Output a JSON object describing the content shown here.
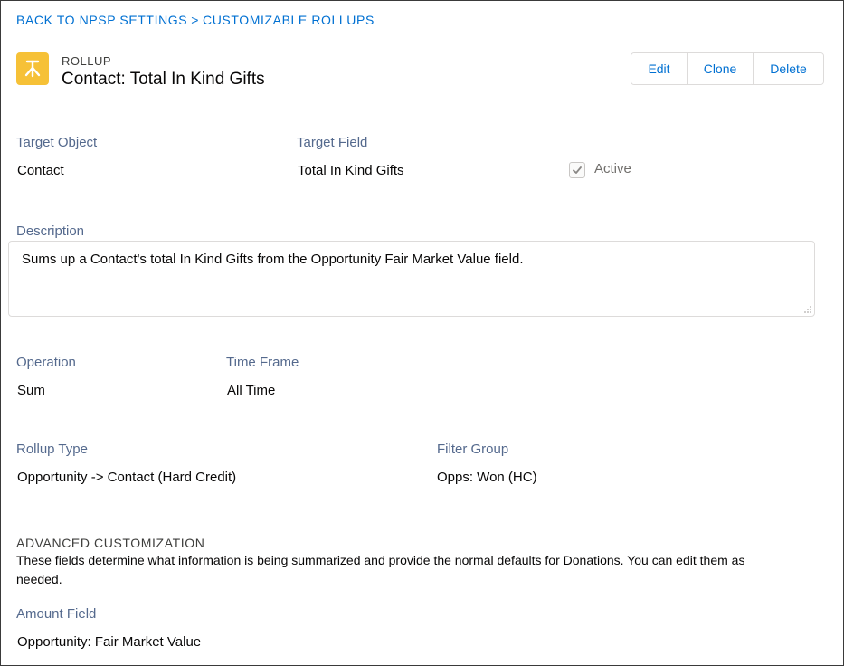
{
  "breadcrumb": {
    "back_label": "BACK TO NPSP SETTINGS",
    "separator": ">",
    "current_label": "CUSTOMIZABLE ROLLUPS"
  },
  "header": {
    "object_type": "ROLLUP",
    "title": "Contact: Total In Kind Gifts",
    "icon": "rollup-icon",
    "icon_color": "#f6c137"
  },
  "actions": {
    "edit_label": "Edit",
    "clone_label": "Clone",
    "delete_label": "Delete"
  },
  "fields": {
    "target_object": {
      "label": "Target Object",
      "value": "Contact"
    },
    "target_field": {
      "label": "Target Field",
      "value": "Total In Kind Gifts"
    },
    "active": {
      "label": "Active",
      "checked": true
    },
    "description": {
      "label": "Description",
      "value": "Sums up a Contact's total In Kind Gifts from the Opportunity Fair Market Value field."
    },
    "operation": {
      "label": "Operation",
      "value": "Sum"
    },
    "time_frame": {
      "label": "Time Frame",
      "value": "All Time"
    },
    "rollup_type": {
      "label": "Rollup Type",
      "value": "Opportunity -> Contact (Hard Credit)"
    },
    "filter_group": {
      "label": "Filter Group",
      "value": "Opps: Won (HC)"
    }
  },
  "advanced": {
    "heading": "ADVANCED CUSTOMIZATION",
    "help_text": "These fields determine what information is being summarized and provide the normal defaults for Donations. You can edit them as needed.",
    "amount_field": {
      "label": "Amount Field",
      "value": "Opportunity: Fair Market Value"
    }
  },
  "colors": {
    "link": "#0070d2",
    "label": "#54698d",
    "text": "#080707"
  }
}
